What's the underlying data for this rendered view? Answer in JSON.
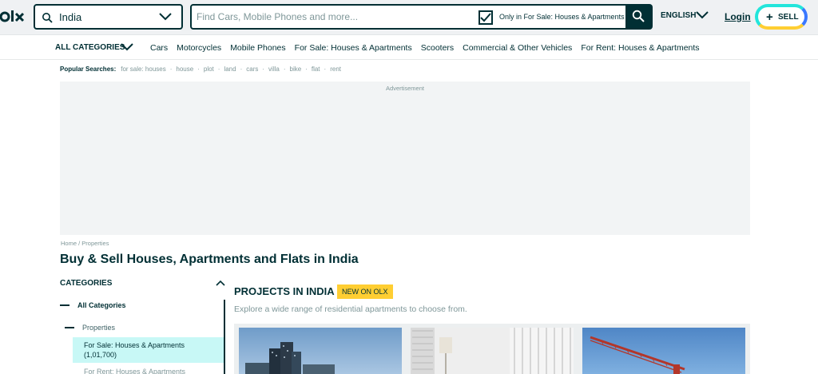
{
  "header": {
    "logo": "OLX",
    "location": {
      "value": "India",
      "icon": "search-icon"
    },
    "search": {
      "placeholder": "Find Cars, Mobile Phones and more...",
      "filter_label": "Only in For Sale: Houses & Apartments",
      "filter_checked": true
    },
    "language": "ENGLISH",
    "login": "Login",
    "sell_label": "SELL",
    "sell_plus": "+"
  },
  "nav": {
    "all_categories": "ALL CATEGORIES",
    "links": [
      "Cars",
      "Motorcycles",
      "Mobile Phones",
      "For Sale: Houses & Apartments",
      "Scooters",
      "Commercial & Other Vehicles",
      "For Rent: Houses & Apartments"
    ]
  },
  "popular": {
    "title": "Popular Searches:",
    "items": [
      "for sale: houses",
      "house",
      "plot",
      "land",
      "cars",
      "villa",
      "bike",
      "flat",
      "rent"
    ]
  },
  "ad": {
    "label": "Advertisement"
  },
  "breadcrumb": [
    "Home",
    "Properties"
  ],
  "page_title": "Buy & Sell Houses, Apartments and Flats in India",
  "sidebar": {
    "title": "CATEGORIES",
    "all_categories": "All Categories",
    "properties": "Properties",
    "active_item": "For Sale: Houses & Apartments",
    "active_count": "(1,01,700)",
    "next_item": "For Rent: Houses & Apartments"
  },
  "projects": {
    "title": "PROJECTS IN INDIA",
    "badge": "NEW ON OLX",
    "subtitle": "Explore a wide range of residential apartments to choose from."
  },
  "colors": {
    "brand_dark": "#002f34",
    "badge_yellow": "#ffce32",
    "active_bg": "#c8f8f6",
    "sell_cyan": "#23e5db",
    "sell_blue": "#3a77ff"
  }
}
